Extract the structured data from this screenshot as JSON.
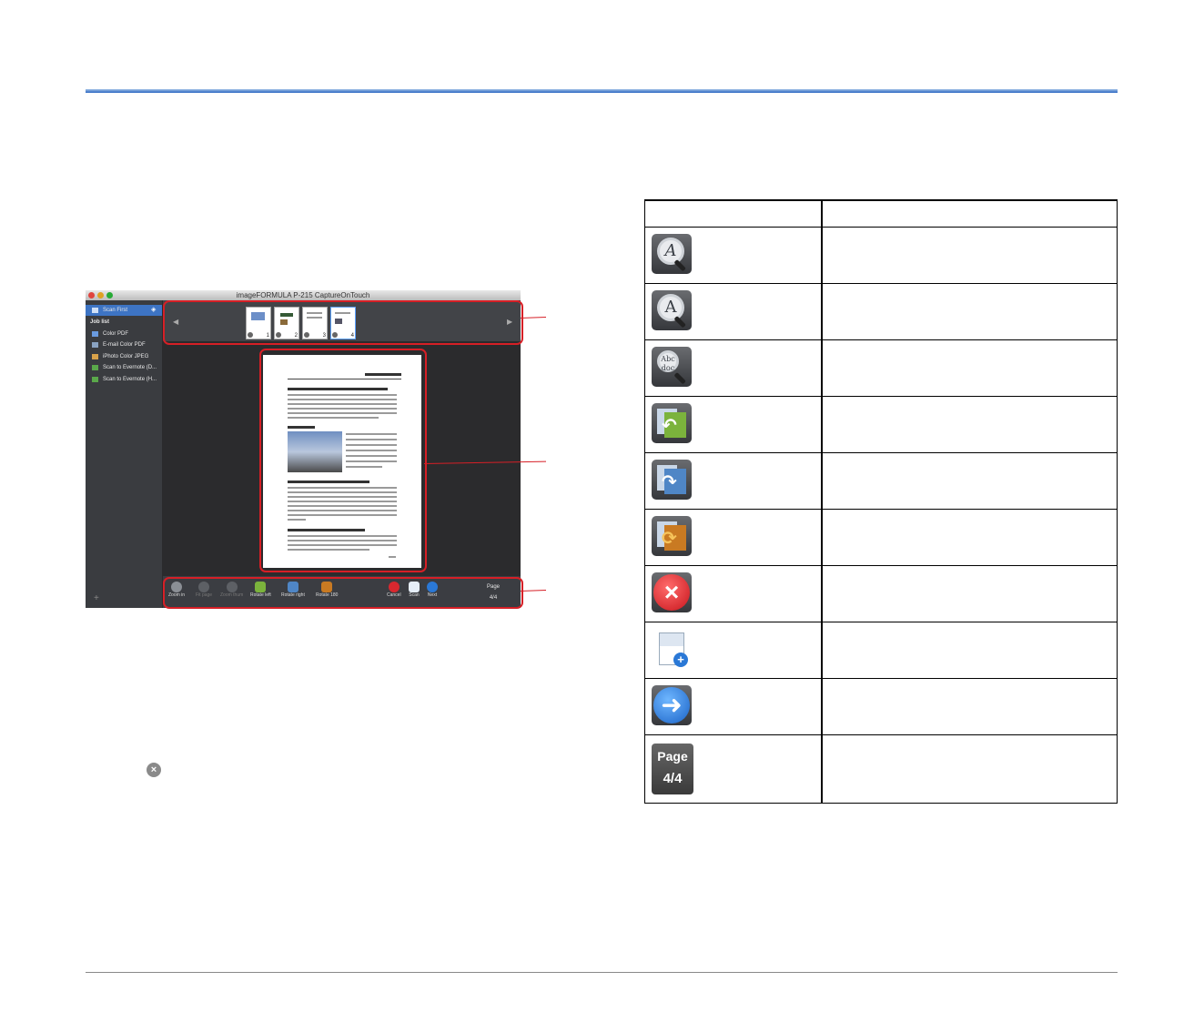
{
  "app": {
    "window_title": "imageFORMULA P-215 CaptureOnTouch",
    "sidebar": {
      "items": [
        {
          "label": "Scan First",
          "icon": "scan-first-icon",
          "selected": true
        },
        {
          "label": "Job list",
          "heading": true
        },
        {
          "label": "Color PDF",
          "icon": "pdf-icon"
        },
        {
          "label": "E-mail Color PDF",
          "icon": "email-icon"
        },
        {
          "label": "iPhoto Color JPEG",
          "icon": "iphoto-icon"
        },
        {
          "label": "Scan to Evernote (D...",
          "icon": "evernote-icon"
        },
        {
          "label": "Scan to Evernote (H...",
          "icon": "evernote-icon"
        }
      ],
      "add_label": "+"
    },
    "thumbnails": [
      "1",
      "2",
      "3",
      "4"
    ],
    "toolbar": {
      "zoom_in": "Zoom in",
      "fit_page": "Fit page",
      "zoom_thumb": "Zoom thum",
      "rotate_left": "Rotate left",
      "rotate_right": "Rotate right",
      "rotate_180": "Rotate 180",
      "cancel": "Cancel",
      "scan": "Scan",
      "next": "Next",
      "page_label": "Page",
      "page_value": "4/4"
    },
    "page_preview": {
      "header": "Momentum et delectis",
      "page_number": "127"
    }
  },
  "table": {
    "icon_rows": [
      "zoom-in-icon",
      "fit-page-icon",
      "zoom-thumbnail-icon",
      "rotate-left-icon",
      "rotate-right-icon",
      "rotate-180-icon",
      "cancel-icon",
      "scan-icon",
      "next-icon",
      "page-counter-icon"
    ],
    "page_counter": {
      "label": "Page",
      "value": "4/4"
    }
  },
  "colors": {
    "callout": "#d61f26",
    "header_rule": "#2a66c2",
    "selection": "#3d74c4"
  }
}
